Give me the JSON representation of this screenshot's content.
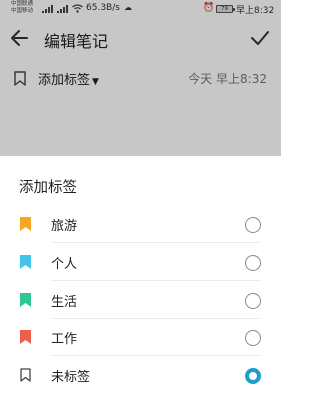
{
  "status_bar": {
    "carrier_1": "中国联通",
    "carrier_2": "中国移动",
    "net_speed": "65.3B/s",
    "battery": "79",
    "time": "早上8:32"
  },
  "toolbar": {
    "title": "编辑笔记"
  },
  "tag_bar": {
    "selected_tag": "添加标签",
    "datetime": "今天 早上8:32"
  },
  "sheet": {
    "title": "添加标签",
    "options": [
      {
        "label": "旅游",
        "color": "#f5a623",
        "selected": false
      },
      {
        "label": "个人",
        "color": "#42c5ea",
        "selected": false
      },
      {
        "label": "生活",
        "color": "#2ec990",
        "selected": false
      },
      {
        "label": "工作",
        "color": "#ef5e4d",
        "selected": false
      },
      {
        "label": "未标签",
        "color": "outline",
        "selected": true
      }
    ],
    "accent_color": "#1b9fc9"
  }
}
